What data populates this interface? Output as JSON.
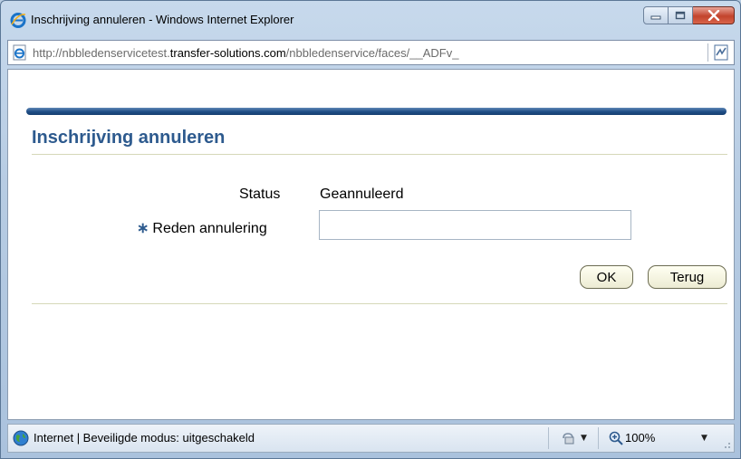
{
  "window": {
    "title": "Inschrijving annuleren - Windows Internet Explorer"
  },
  "address_bar": {
    "url_prefix": "http://nbbledenservicetest.",
    "url_domain": "transfer-solutions.com",
    "url_suffix": "/nbbledenservice/faces/__ADFv_"
  },
  "page": {
    "title": "Inschrijving annuleren",
    "status_label": "Status",
    "status_value": "Geannuleerd",
    "required_marker": "∗",
    "reason_label": "Reden annulering",
    "reason_value": "",
    "ok_button": "OK",
    "back_button": "Terug"
  },
  "status_bar": {
    "zone_text": "Internet | Beveiligde modus: uitgeschakeld",
    "zoom": "100%"
  },
  "colors": {
    "heading": "#2d5a8e",
    "brand_bar": "#1f4e86",
    "close_button": "#c2432c"
  },
  "icons": {
    "app": "ie-logo-icon",
    "page": "page-icon",
    "compat": "compatibility-view-icon",
    "zone": "globe-icon",
    "security": "protected-mode-icon",
    "zoom": "magnifier-icon"
  }
}
